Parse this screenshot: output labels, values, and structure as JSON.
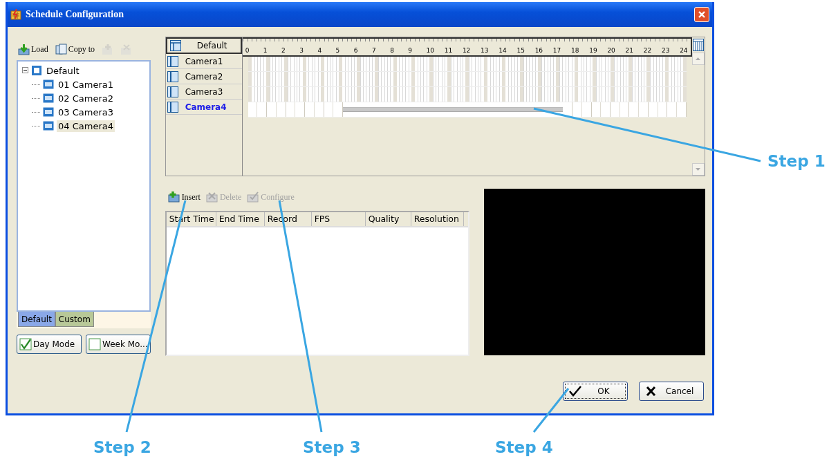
{
  "window": {
    "title": "Schedule Configuration"
  },
  "toolbar": [
    {
      "label": "Load",
      "kind": "load",
      "disabled": false
    },
    {
      "label": "Copy to",
      "kind": "copy",
      "disabled": false
    },
    {
      "kind": "add",
      "disabled": true
    },
    {
      "kind": "remove",
      "disabled": true
    }
  ],
  "tree": {
    "label": "Default",
    "expanded": true,
    "children": [
      {
        "label": "01 Camera1",
        "selected": false
      },
      {
        "label": "02 Camera2",
        "selected": false
      },
      {
        "label": "03 Camera3",
        "selected": false
      },
      {
        "label": "04 Camera4",
        "selected": true
      }
    ]
  },
  "tabs": [
    {
      "label": "Default",
      "selected": true
    },
    {
      "label": "Custom",
      "selected": false
    }
  ],
  "modes": [
    {
      "label": "Day Mode",
      "checked": true
    },
    {
      "label": "Week Mo...",
      "checked": false
    }
  ],
  "schedule": {
    "header": "Default",
    "hours": [
      "0",
      "1",
      "2",
      "3",
      "4",
      "5",
      "6",
      "7",
      "8",
      "9",
      "10",
      "11",
      "12",
      "13",
      "14",
      "15",
      "16",
      "17",
      "18",
      "19",
      "20",
      "21",
      "22",
      "23",
      "24"
    ],
    "rows": [
      {
        "name": "Camera1",
        "selected": false
      },
      {
        "name": "Camera2",
        "selected": false
      },
      {
        "name": "Camera3",
        "selected": false
      },
      {
        "name": "Camera4",
        "selected": true,
        "half_hours": [
          false,
          false,
          false,
          false,
          false,
          false,
          false,
          false,
          false,
          false,
          true,
          true,
          true,
          true,
          true,
          true,
          true,
          true,
          true,
          true,
          true,
          true,
          true,
          true,
          true,
          true,
          true,
          true,
          true,
          true,
          true,
          true,
          true,
          true,
          true,
          false,
          false,
          false,
          false,
          false,
          false,
          false,
          false,
          false,
          false,
          false,
          false,
          false
        ]
      }
    ]
  },
  "actions": [
    {
      "label": "Insert",
      "kind": "insert",
      "disabled": false
    },
    {
      "label": "Delete",
      "kind": "delete",
      "disabled": true
    },
    {
      "label": "Configure",
      "kind": "configure",
      "disabled": true
    }
  ],
  "table": {
    "columns": [
      "Start Time",
      "End Time",
      "Record",
      "FPS",
      "Quality",
      "Resolution"
    ]
  },
  "buttons": [
    {
      "label": "OK",
      "kind": "ok"
    },
    {
      "label": "Cancel",
      "kind": "cancel"
    }
  ],
  "callouts": [
    {
      "label": "Step 1"
    },
    {
      "label": "Step 2"
    },
    {
      "label": "Step 3"
    },
    {
      "label": "Step 4"
    }
  ]
}
